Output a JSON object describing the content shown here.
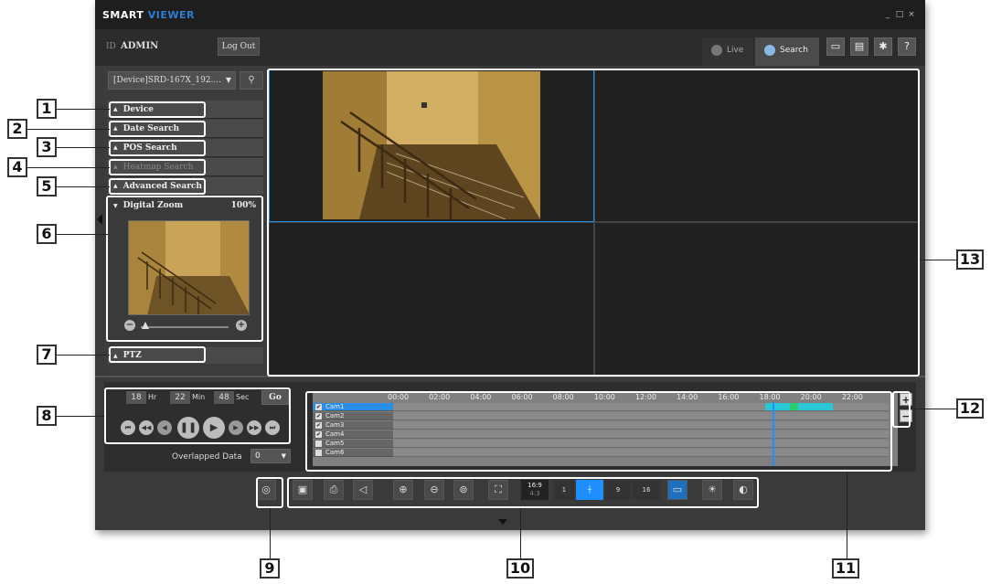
{
  "app": {
    "brand_part1": "SMART",
    "brand_part2": "VIEWER",
    "win_min": "_",
    "win_max": "□",
    "win_close": "×"
  },
  "header": {
    "id_label": "ID",
    "user": "ADMIN",
    "logout": "Log Out",
    "tab_live": "Live",
    "tab_search": "Search",
    "help": "?"
  },
  "left": {
    "device_select": "[Device]SRD-167X_192....",
    "sections": [
      "Device",
      "Date Search",
      "POS Search",
      "Heatmap Search",
      "Advanced Search"
    ],
    "digital_zoom": "Digital Zoom",
    "zoom_percent": "100%",
    "zoom_level": 0.05,
    "ptz": "PTZ"
  },
  "time": {
    "hr": "18",
    "hr_label": "Hr",
    "min": "22",
    "min_label": "Min",
    "sec": "48",
    "sec_label": "Sec",
    "go": "Go"
  },
  "overlapped": {
    "label": "Overlapped Data",
    "value": "0"
  },
  "timeline": {
    "hours": [
      "00:00",
      "02:00",
      "04:00",
      "06:00",
      "08:00",
      "10:00",
      "12:00",
      "14:00",
      "16:00",
      "18:00",
      "20:00",
      "22:00"
    ],
    "cameras": [
      "Cam1",
      "Cam2",
      "Cam3",
      "Cam4",
      "Cam5",
      "Cam6"
    ],
    "checked": [
      true,
      true,
      true,
      true,
      false,
      false
    ],
    "selected_index": 0,
    "cursor_time": "18:22:48",
    "zoom_in": "+",
    "zoom_out": "−"
  },
  "toolbar": {
    "ratio_top": "16:9",
    "ratio_bottom": "4:3",
    "split_1": "1",
    "split_9": "9",
    "split_16": "16"
  },
  "callouts": [
    "1",
    "2",
    "3",
    "4",
    "5",
    "6",
    "7",
    "8",
    "9",
    "10",
    "11",
    "12",
    "13"
  ],
  "colors": {
    "accent_blue": "#2a8de6",
    "recording_cyan": "#29c7d8",
    "recording_green": "#2ecc71"
  }
}
